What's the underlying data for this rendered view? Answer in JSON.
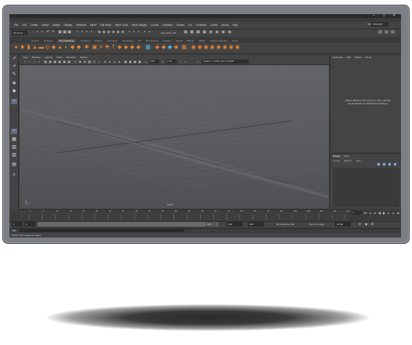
{
  "window": {
    "minimize": "–",
    "maximize": "□",
    "close": "✕"
  },
  "menus": [
    "File",
    "Edit",
    "Create",
    "Select",
    "Modify",
    "Display",
    "Windows",
    "Mesh",
    "Edit Mesh",
    "Mesh Tools",
    "Mesh Display",
    "Curves",
    "Surfaces",
    "Deform",
    "UV",
    "Generate",
    "Cache",
    "Arnold",
    "Help"
  ],
  "workspace": {
    "label": "Workspace:",
    "value": "General*"
  },
  "status_line": {
    "mode": "Modeling",
    "symmetry": "Symmetry: Off"
  },
  "shelf_tabs": [
    "Curves",
    "Surfaces",
    "Poly Modeling",
    "Sculpting",
    "Rigging",
    "Animation",
    "Rendering",
    "FX",
    "FX Caching",
    "Custom",
    "Arnold",
    "Bifrost",
    "MASH",
    "Motion Graphics",
    "XGen"
  ],
  "shelf_active": "Poly Modeling",
  "viewport": {
    "menus": [
      "View",
      "Shading",
      "Lighting",
      "Show",
      "Renderer",
      "Panels"
    ],
    "near_value": "0.00",
    "far_value": "1.00",
    "colorspace": "ACES 1.0 SDR-video (sRGB)",
    "camera": "persp"
  },
  "channel_box": {
    "tabs": [
      "Channels",
      "Edit",
      "Object",
      "Show"
    ],
    "message": "Select objects in the scene to view, edit and set keyframes on channels and history."
  },
  "layer_editor": {
    "tabs": [
      "Display",
      "Anim"
    ],
    "active_tab": "Display",
    "menus": [
      "Layers",
      "Options",
      "Help"
    ]
  },
  "timeline": {
    "ticks": [
      "1",
      "5",
      "10",
      "15",
      "20",
      "25",
      "30",
      "35",
      "40",
      "45",
      "50",
      "55",
      "60",
      "65",
      "70",
      "75",
      "80",
      "85",
      "90",
      "95",
      "100",
      "105",
      "110",
      "115",
      "120"
    ],
    "current_frame": "1"
  },
  "range": {
    "start": "1",
    "playback_start": "1",
    "slider_end": "120",
    "playback_end": "120",
    "end": "200",
    "character_set": "No Character Set",
    "anim_layer": "No Anim Layer",
    "fps": "24 fps"
  },
  "command_line": {
    "label": "MEL"
  },
  "help_line": {
    "text": "Select Tool: select an object"
  },
  "colors": {
    "accent_orange": "#e3812f",
    "accent_blue": "#4fb4e6",
    "maya_badge": "#1b9fc7"
  }
}
